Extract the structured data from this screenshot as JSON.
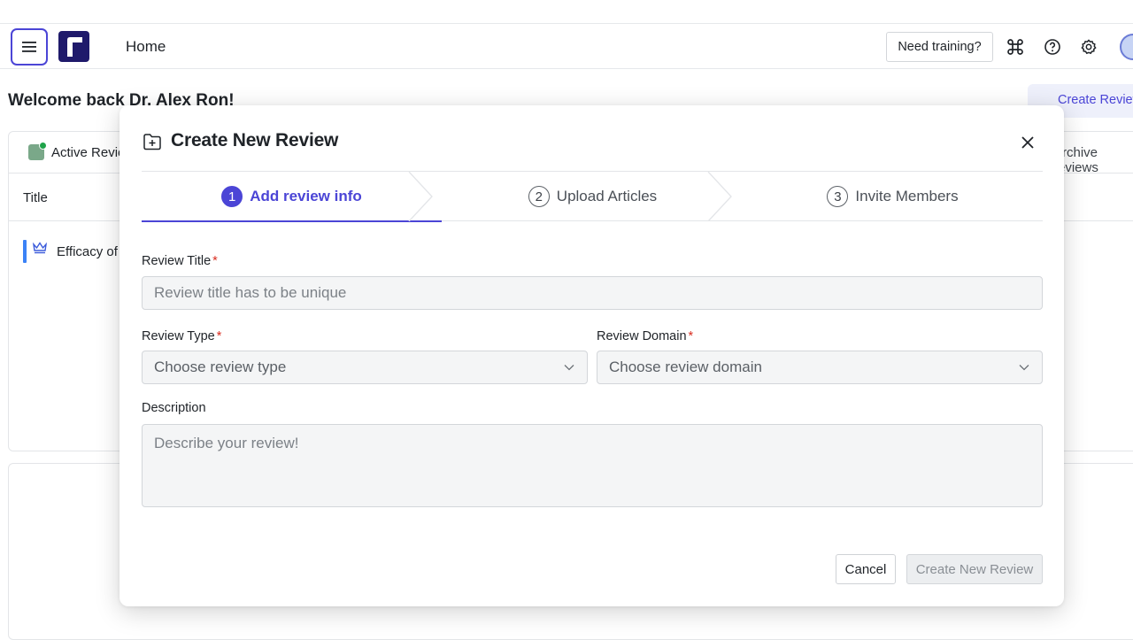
{
  "header": {
    "home_label": "Home",
    "training_label": "Need training?",
    "icons": [
      "menu-icon",
      "command-icon",
      "help-icon",
      "settings-icon"
    ]
  },
  "page": {
    "welcome_text": "Welcome back Dr. Alex Ron!",
    "create_review_label": "Create Review",
    "tab_active_label": "Active Reviews",
    "tab_right_label": "Archive reviews",
    "column_title": "Title",
    "row_title": "Efficacy of"
  },
  "modal": {
    "title": "Create New Review",
    "steps": [
      {
        "num": "1",
        "label": "Add review info",
        "active": true
      },
      {
        "num": "2",
        "label": "Upload Articles",
        "active": false
      },
      {
        "num": "3",
        "label": "Invite Members",
        "active": false
      }
    ],
    "review_title": {
      "label": "Review Title",
      "required_mark": "*",
      "placeholder": "Review title has to be unique"
    },
    "review_type": {
      "label": "Review Type",
      "required_mark": "*",
      "placeholder": "Choose review type"
    },
    "review_domain": {
      "label": "Review Domain",
      "required_mark": "*",
      "placeholder": "Choose review domain"
    },
    "description": {
      "label": "Description",
      "placeholder": "Describe your review!"
    },
    "cancel_label": "Cancel",
    "submit_label": "Create New Review"
  },
  "colors": {
    "accent": "#4b45d6",
    "required": "#d92d20",
    "logo_bg": "#1f1a6b"
  }
}
